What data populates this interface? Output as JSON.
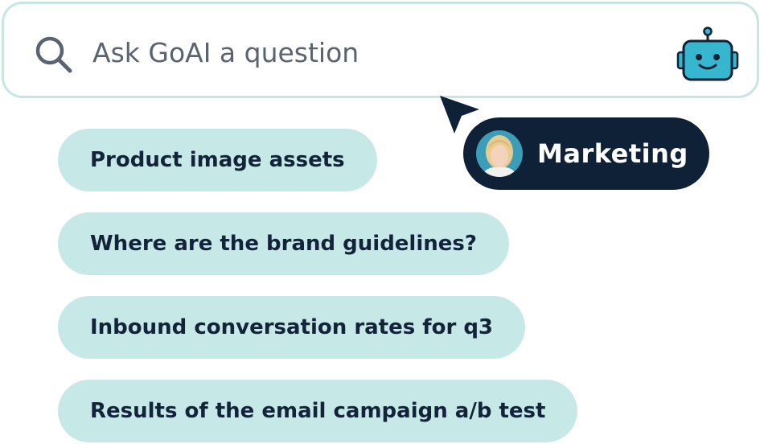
{
  "search": {
    "placeholder": "Ask GoAI a question",
    "search_icon": "search-icon",
    "assistant_icon": "robot-icon"
  },
  "user_tag": {
    "label": "Marketing",
    "avatar": "avatar",
    "pointer_icon": "cursor-icon"
  },
  "suggestions": [
    "Product image assets",
    "Where are the brand guidelines?",
    "Inbound conversation rates for q3",
    "Results of the email campaign a/b test"
  ],
  "colors": {
    "search_border": "#c5e6e4",
    "chip_background": "#c6e9e7",
    "chip_text": "#13243a",
    "tag_background": "#0f2136",
    "robot": "#37b6cf",
    "robot_outline": "#0f2136"
  }
}
